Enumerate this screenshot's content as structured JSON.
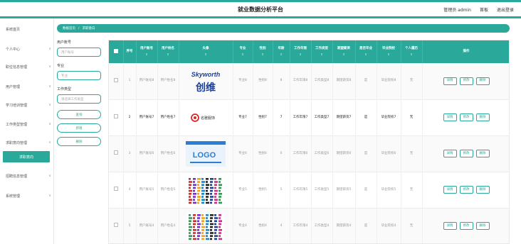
{
  "header": {
    "app_title": "就业数据分析平台",
    "admin_label": "管理员 admin",
    "home_link": "首板",
    "logout_link": "退出登录"
  },
  "sidebar": {
    "items": [
      {
        "label": "系统首页"
      },
      {
        "label": "个人中心"
      },
      {
        "label": "职位信息管理"
      },
      {
        "label": "用户管理"
      },
      {
        "label": "学习培训管理"
      },
      {
        "label": "工作类型管理"
      },
      {
        "label": "求职意向管理"
      },
      {
        "label": "招聘信息管理"
      },
      {
        "label": "系统管理"
      }
    ],
    "active_sub": "求职意向"
  },
  "breadcrumb": {
    "home": "数据首页",
    "separator": "/",
    "current": "求职意向"
  },
  "search": {
    "account_label": "用户账号",
    "account_placeholder": "用户账号",
    "major_label": "专业",
    "major_placeholder": "专业",
    "worktype_label": "工作类型",
    "worktype_placeholder": "请选择工作类型",
    "search_btn": "查询",
    "add_btn": "新增",
    "delete_btn": "删除"
  },
  "table": {
    "headers": [
      "序号",
      "用户账号",
      "用户姓名",
      "头像",
      "专业",
      "性别",
      "年龄",
      "工作年限",
      "工作类型",
      "期望薪资",
      "是否毕业",
      "毕业院校",
      "个人履历",
      "操作"
    ],
    "rows": [
      {
        "index": "1",
        "account": "用户账号8",
        "name": "用户姓名8",
        "major": "专业8",
        "gender": "性别8",
        "age": "8",
        "years": "工作年限8",
        "type": "工作类型8",
        "salary": "期望薪资8",
        "graduated": "是",
        "school": "毕业院校8",
        "resume": "无"
      },
      {
        "index": "2",
        "account": "用户账号7",
        "name": "用户姓名7",
        "major": "专业7",
        "gender": "性别7",
        "age": "7",
        "years": "工作年限7",
        "type": "工作类型7",
        "salary": "期望薪资7",
        "graduated": "是",
        "school": "毕业院校7",
        "resume": "无"
      },
      {
        "index": "3",
        "account": "用户账号6",
        "name": "用户姓名6",
        "major": "专业6",
        "gender": "性别6",
        "age": "6",
        "years": "工作年限6",
        "type": "工作类型6",
        "salary": "期望薪资6",
        "graduated": "是",
        "school": "毕业院校6",
        "resume": "无"
      },
      {
        "index": "4",
        "account": "用户账号5",
        "name": "用户姓名5",
        "major": "专业5",
        "gender": "性别5",
        "age": "5",
        "years": "工作年限5",
        "type": "工作类型5",
        "salary": "期望薪资5",
        "graduated": "是",
        "school": "毕业院校5",
        "resume": "无"
      },
      {
        "index": "5",
        "account": "用户账号4",
        "name": "用户姓名4",
        "major": "专业4",
        "gender": "性别4",
        "age": "4",
        "years": "工作年限4",
        "type": "工作类型4",
        "salary": "期望薪资4",
        "graduated": "是",
        "school": "毕业院校4",
        "resume": "无"
      }
    ],
    "ops": {
      "detail": "详情",
      "edit": "修改",
      "delete": "删除"
    }
  },
  "logos": {
    "skyworth_top": "Skyworth",
    "skyworth_bottom": "创维",
    "brand2": "名雅服饰",
    "logo_text": "LOGO"
  },
  "colors": {
    "accent": "#2aa99a",
    "skyworth_blue": "#1a3f9c"
  }
}
